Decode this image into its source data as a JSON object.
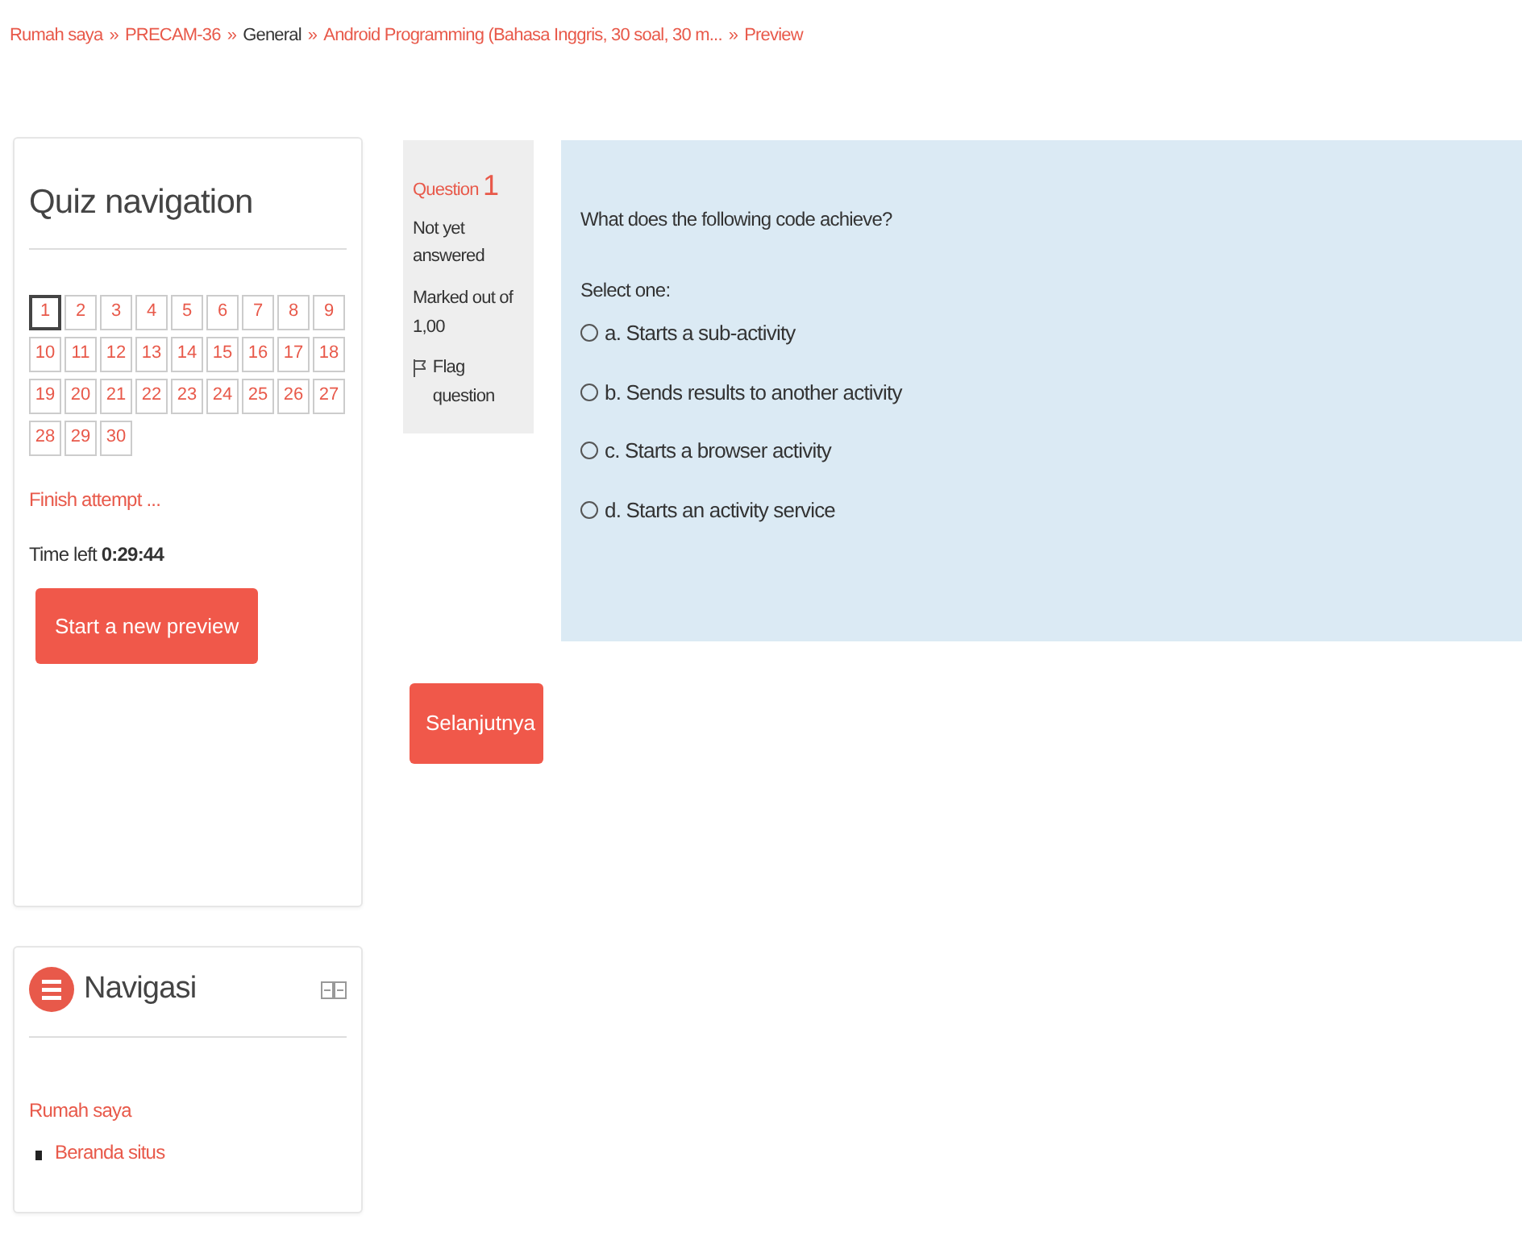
{
  "breadcrumb": [
    {
      "text": "Rumah saya",
      "link": true
    },
    {
      "text": "PRECAM-36",
      "link": true
    },
    {
      "text": "General",
      "link": false
    },
    {
      "text": "Android Programming (Bahasa Inggris, 30 soal, 30 m...",
      "link": true
    },
    {
      "text": "Preview",
      "link": true
    }
  ],
  "breadcrumb_separator": "»",
  "quiz_navigation": {
    "title": "Quiz navigation",
    "questions": [
      {
        "label": "1",
        "selected": true
      },
      {
        "label": "2",
        "selected": false
      },
      {
        "label": "3",
        "selected": false
      },
      {
        "label": "4",
        "selected": false
      },
      {
        "label": "5",
        "selected": false
      },
      {
        "label": "6",
        "selected": false
      },
      {
        "label": "7",
        "selected": false
      },
      {
        "label": "8",
        "selected": false
      },
      {
        "label": "9",
        "selected": false
      },
      {
        "label": "10",
        "selected": false
      },
      {
        "label": "11",
        "selected": false
      },
      {
        "label": "12",
        "selected": false
      },
      {
        "label": "13",
        "selected": false
      },
      {
        "label": "14",
        "selected": false
      },
      {
        "label": "15",
        "selected": false
      },
      {
        "label": "16",
        "selected": false
      },
      {
        "label": "17",
        "selected": false
      },
      {
        "label": "18",
        "selected": false
      },
      {
        "label": "19",
        "selected": false
      },
      {
        "label": "20",
        "selected": false
      },
      {
        "label": "21",
        "selected": false
      },
      {
        "label": "22",
        "selected": false
      },
      {
        "label": "23",
        "selected": false
      },
      {
        "label": "24",
        "selected": false
      },
      {
        "label": "25",
        "selected": false
      },
      {
        "label": "26",
        "selected": false
      },
      {
        "label": "27",
        "selected": false
      },
      {
        "label": "28",
        "selected": false
      },
      {
        "label": "29",
        "selected": false
      },
      {
        "label": "30",
        "selected": false
      }
    ],
    "finish_link": "Finish attempt ...",
    "time_label": "Time left",
    "time_value": "0:29:44",
    "new_preview_button": "Start a new preview"
  },
  "question_info": {
    "label": "Question",
    "number": "1",
    "state": "Not yet answered",
    "marks": "Marked out of 1,00",
    "flag": "Flag question"
  },
  "question": {
    "text": "What does the following code achieve?",
    "prompt": "Select one:",
    "options": [
      {
        "label": "a. Starts a sub-activity",
        "selected": false
      },
      {
        "label": "b. Sends results to another activity",
        "selected": false
      },
      {
        "label": "c. Starts a browser activity",
        "selected": false
      },
      {
        "label": "d. Starts an activity service",
        "selected": false
      }
    ]
  },
  "next_button": "Selanjutnya",
  "navigation_block": {
    "title": "Navigasi",
    "items": [
      {
        "text": "Rumah saya",
        "children": [
          {
            "text": "Beranda situs"
          }
        ]
      }
    ]
  }
}
